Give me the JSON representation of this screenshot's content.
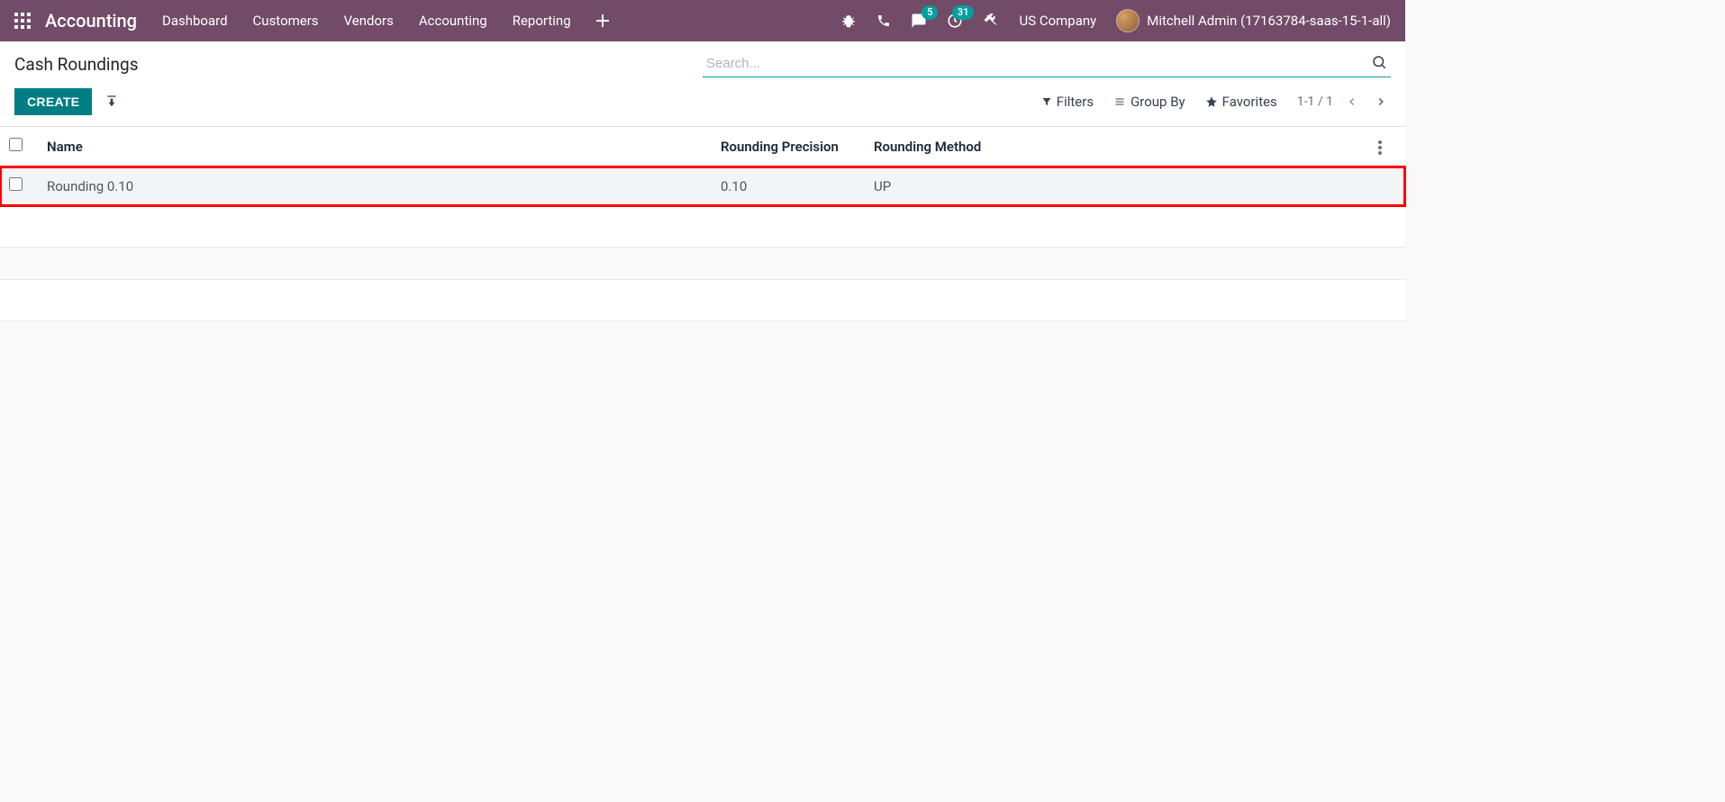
{
  "navbar": {
    "brand": "Accounting",
    "menu": [
      "Dashboard",
      "Customers",
      "Vendors",
      "Accounting",
      "Reporting"
    ],
    "messages_badge": "5",
    "activities_badge": "31",
    "company": "US Company",
    "user": "Mitchell Admin (17163784-saas-15-1-all)"
  },
  "page": {
    "title": "Cash Roundings",
    "create_label": "CREATE",
    "search_placeholder": "Search..."
  },
  "search_options": {
    "filters": "Filters",
    "group_by": "Group By",
    "favorites": "Favorites"
  },
  "pager": {
    "range": "1-1 / 1"
  },
  "table": {
    "headers": {
      "name": "Name",
      "precision": "Rounding Precision",
      "method": "Rounding Method"
    },
    "rows": [
      {
        "name": "Rounding 0.10",
        "precision": "0.10",
        "method": "UP"
      }
    ]
  }
}
